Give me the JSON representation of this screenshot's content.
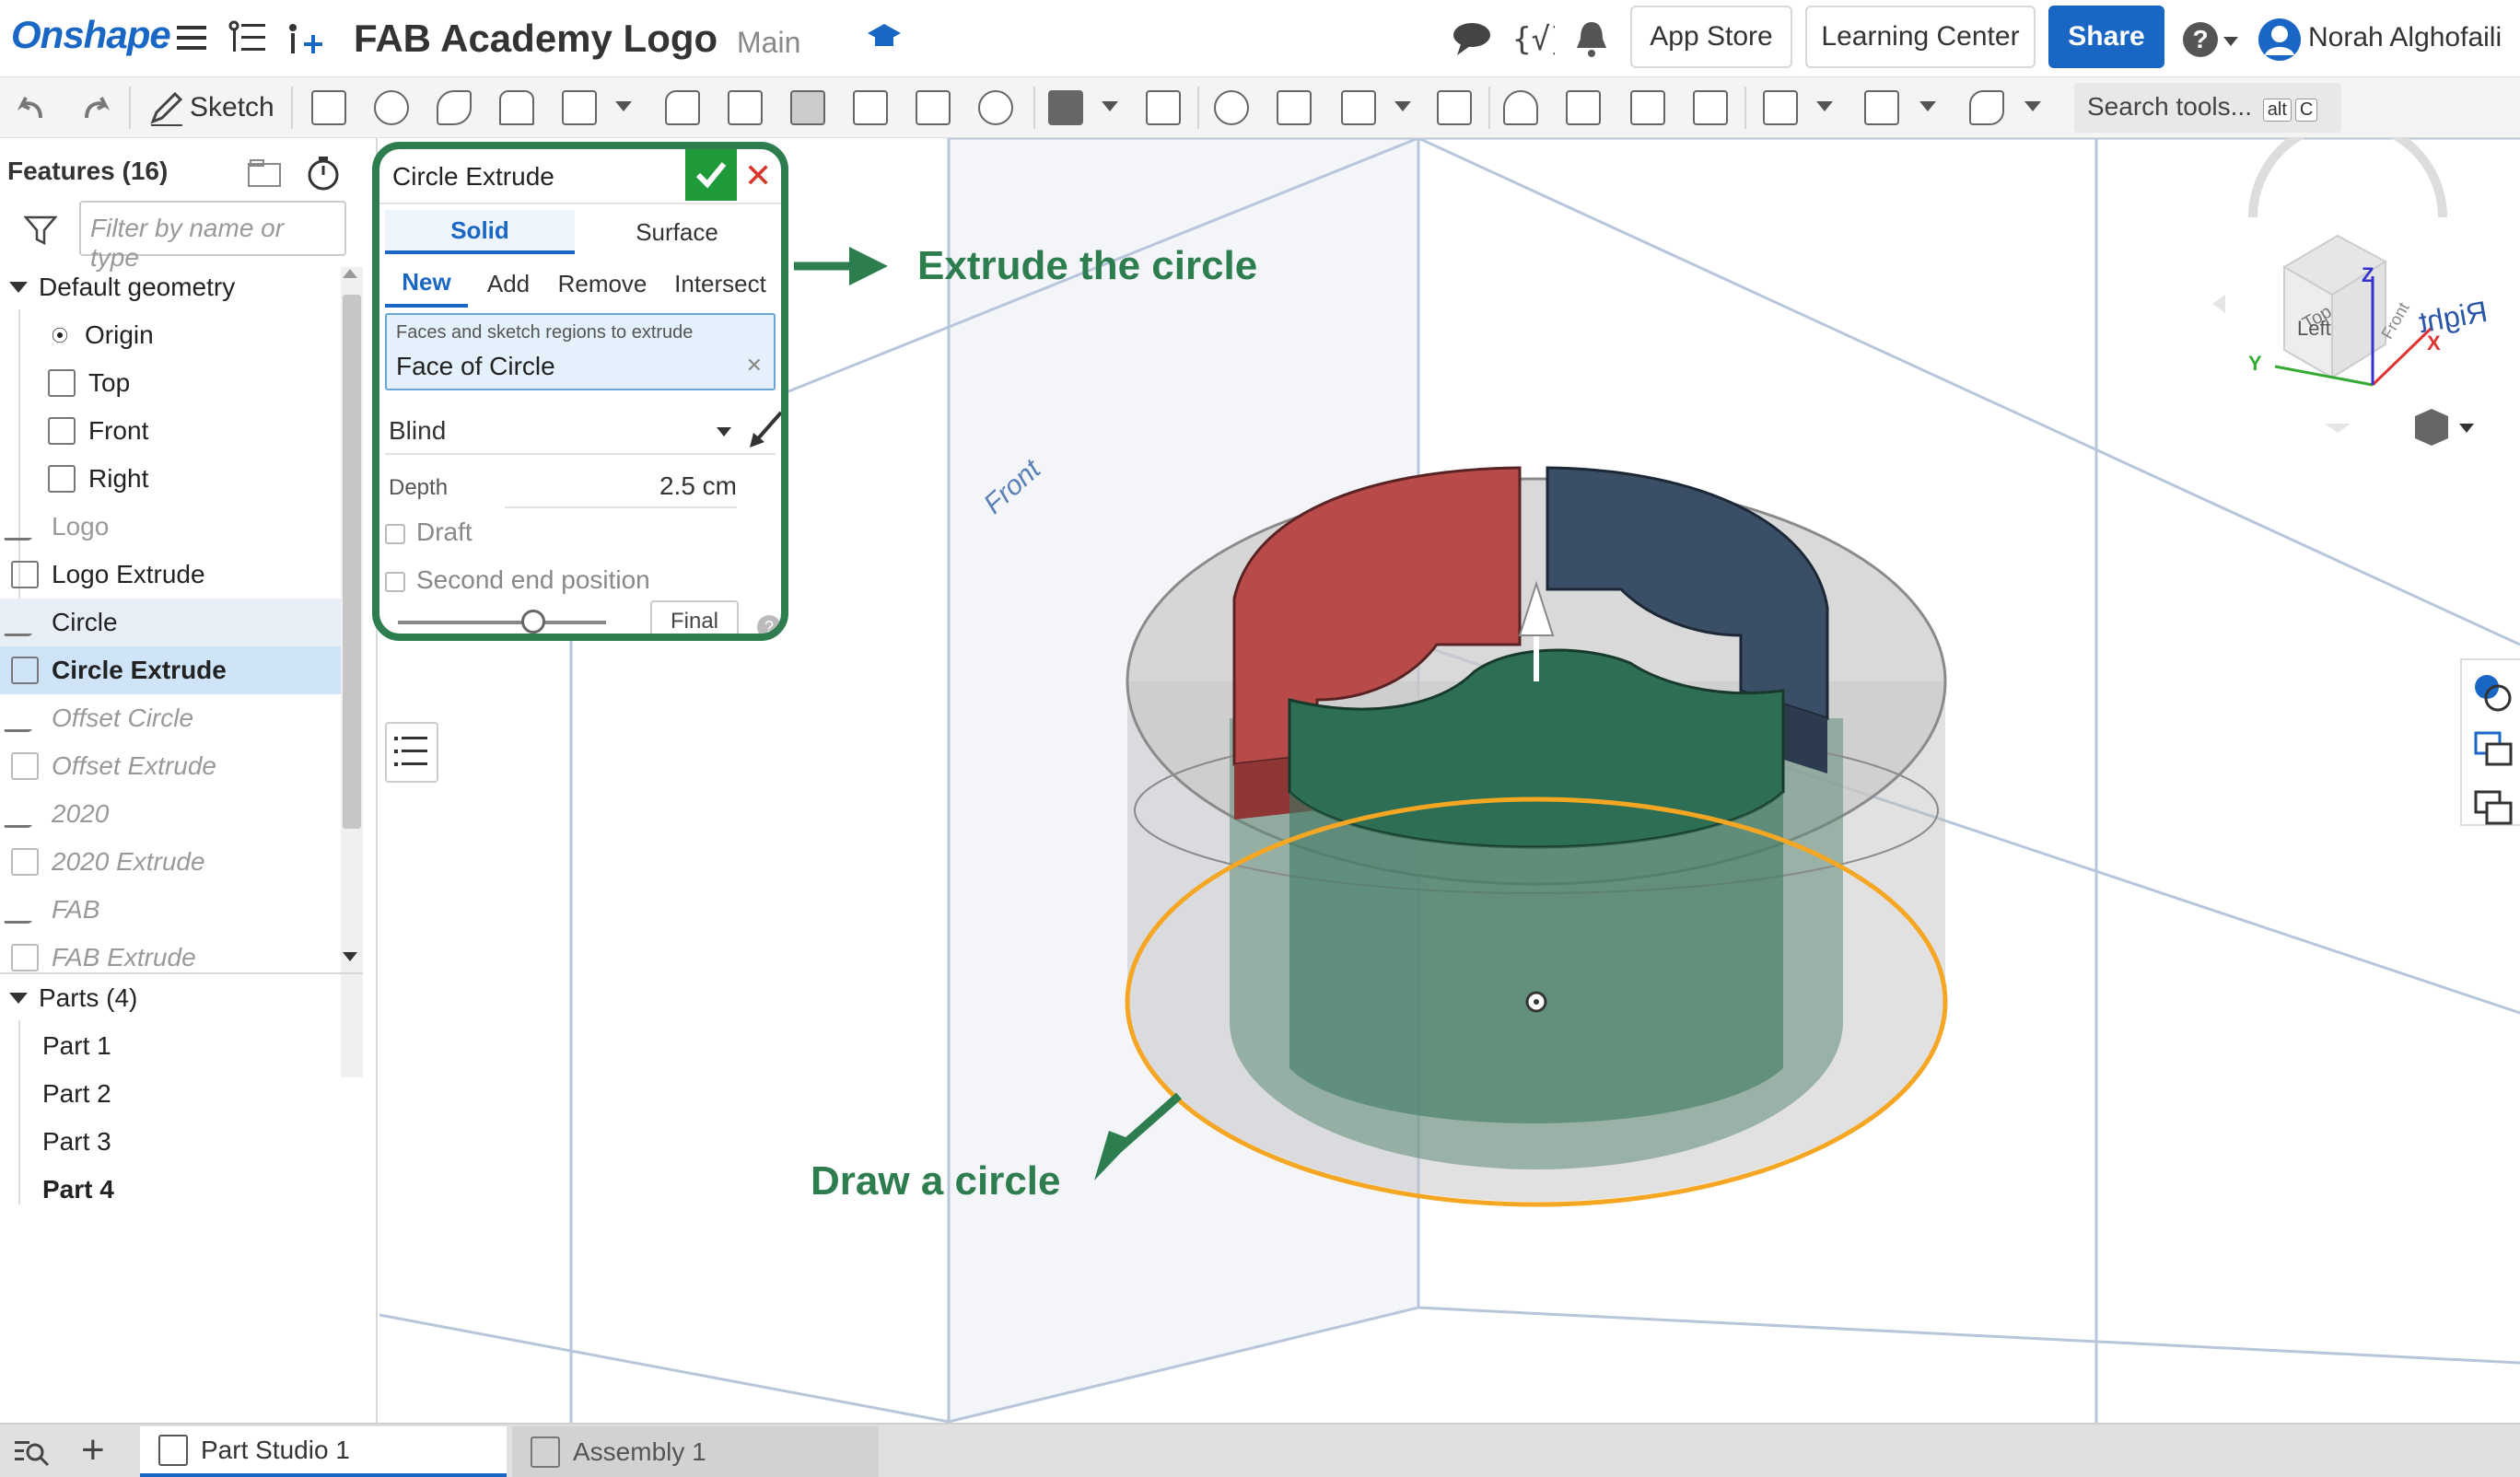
{
  "app": {
    "brand": "Onshape",
    "doc_title": "FAB Academy Logo",
    "branch": "Main"
  },
  "header": {
    "app_store": "App Store",
    "learning_center": "Learning Center",
    "share": "Share",
    "help": "?",
    "user": "Norah Alghofaili"
  },
  "toolbar": {
    "sketch": "Sketch",
    "search_placeholder": "Search tools...",
    "search_shortcut_1": "alt",
    "search_shortcut_2": "C"
  },
  "features": {
    "header": "Features (16)",
    "filter_placeholder": "Filter by name or type",
    "default_geometry": "Default geometry",
    "items": [
      "Origin",
      "Top",
      "Front",
      "Right",
      "Logo",
      "Logo Extrude",
      "Circle",
      "Circle Extrude",
      "Offset Circle",
      "Offset Extrude",
      "2020",
      "2020 Extrude",
      "FAB",
      "FAB Extrude"
    ],
    "parts_header": "Parts (4)",
    "parts": [
      "Part 1",
      "Part 2",
      "Part 3",
      "Part 4"
    ]
  },
  "dialog": {
    "title": "Circle Extrude",
    "tab_solid": "Solid",
    "tab_surface": "Surface",
    "op_new": "New",
    "op_add": "Add",
    "op_remove": "Remove",
    "op_intersect": "Intersect",
    "query_caption": "Faces and sketch regions to extrude",
    "query_value": "Face of Circle",
    "end_type": "Blind",
    "depth_label": "Depth",
    "depth_value": "2.5 cm",
    "draft": "Draft",
    "second_end": "Second end position",
    "final": "Final",
    "rollback_fraction": 0.65
  },
  "annotations": {
    "extrude": "Extrude the circle",
    "draw": "Draw a circle"
  },
  "viewport": {
    "plane_label": "Front",
    "cube_left": "Left",
    "cube_front": "Front",
    "cube_top": "Top",
    "right_label": "Right",
    "axis_x": "X",
    "axis_y": "Y",
    "axis_z": "Z"
  },
  "tabs": {
    "part_studio": "Part Studio 1",
    "assembly": "Assembly 1"
  },
  "colors": {
    "accent": "#1a66c4",
    "annotation": "#2d7d4f",
    "selection": "#f5a623",
    "part_red": "#b84a4a",
    "part_blue": "#3a4e66",
    "part_green": "#2e6e55"
  }
}
